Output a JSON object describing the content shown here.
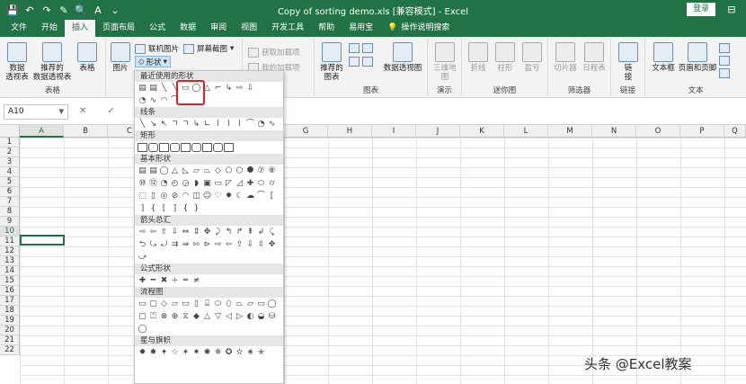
{
  "window": {
    "title": "Copy of sorting demo.xls  [兼容模式]  -  Excel",
    "login_label": "登录",
    "qat_icons": [
      "save-icon",
      "undo-icon",
      "redo-icon",
      "format-painter-icon",
      "print-preview-icon",
      "font-color-icon",
      "customize-qat-icon"
    ]
  },
  "tabs": [
    "文件",
    "开始",
    "插入",
    "页面布局",
    "公式",
    "数据",
    "审阅",
    "视图",
    "开发工具",
    "帮助",
    "易用宝"
  ],
  "active_tab": "插入",
  "tell_me": "操作说明搜索",
  "ribbon": {
    "groups": {
      "tables": {
        "label": "表格",
        "pivot": "数据\n透视表",
        "recommended_pivot": "推荐的\n数据透视表",
        "table": "表格"
      },
      "illustrations": {
        "picture": "图片",
        "online_picture": "联机图片",
        "shapes": "形状",
        "screenshot": "屏幕截图"
      },
      "addins": {
        "get_addins": "获取加载项",
        "my_addins": "我的加载项"
      },
      "charts": {
        "label": "图表",
        "recommended_charts": "推荐的\n图表",
        "pivot_chart": "数据透视图"
      },
      "tours": {
        "label": "演示",
        "map3d": "三维地\n图"
      },
      "sparklines": {
        "label": "迷你图",
        "line": "折线",
        "column": "柱形",
        "winloss": "盈亏"
      },
      "filters": {
        "label": "筛选器",
        "slicer": "切片器",
        "timeline": "日程表"
      },
      "links": {
        "label": "链接",
        "link": "链\n接"
      },
      "text": {
        "label": "文本",
        "textbox": "文本框",
        "header_footer": "页眉和页脚"
      }
    }
  },
  "formula_bar": {
    "name_box": "A10",
    "buttons": "✕ ✓ fx"
  },
  "columns": [
    "A",
    "B",
    "C",
    "D",
    "E",
    "F",
    "G",
    "H",
    "I",
    "J",
    "K",
    "L",
    "M",
    "N",
    "O",
    "P",
    "Q"
  ],
  "rows": [
    "1",
    "2",
    "3",
    "4",
    "5",
    "6",
    "7",
    "8",
    "9",
    "10",
    "11",
    "12",
    "13",
    "14",
    "15",
    "16",
    "17",
    "18",
    "19",
    "20",
    "21",
    "22"
  ],
  "selected_cell": "A10",
  "shapes_menu": {
    "categories": [
      "最近使用的形状",
      "线条",
      "矩形",
      "基本形状",
      "箭头总汇",
      "公式形状",
      "流程图",
      "星与旗帜"
    ],
    "recent_glyphs": [
      "▤",
      "▤",
      "╲",
      "╲",
      "▭",
      "◯",
      "△",
      "⌐",
      "↳",
      "⇨",
      "⇩"
    ],
    "recent_glyphs_2": [
      "◔",
      "∿",
      "◠",
      "⌒"
    ],
    "line_glyphs": [
      "╲",
      "↘",
      "↖",
      "ㄱ",
      "ㄱ",
      "↳",
      "∟",
      "⌇",
      "⌇",
      "⌇",
      "⌒",
      "◔",
      "∿"
    ],
    "rect_count": 9,
    "basic_glyphs": [
      "▤",
      "▤",
      "◯",
      "△",
      "◺",
      "▱",
      "⏢",
      "◇",
      "⬠",
      "⬡",
      "⯃",
      "⑦",
      "⑧",
      "⑩",
      "⑫",
      "◔",
      "◴",
      "◶",
      "◗",
      "▣",
      "▭",
      "◸",
      "◿",
      "✚",
      "⬭",
      "⌭",
      "⬚",
      "▯",
      "◎",
      "⊘",
      "◠",
      "◫",
      "☺",
      "♡",
      "✹",
      "☾",
      "☁",
      "⌒",
      "[",
      "]",
      "{",
      "[",
      "]",
      "{",
      "}"
    ],
    "arrow_glyphs": [
      "⇨",
      "⇦",
      "⇧",
      "⇩",
      "⇔",
      "⇕",
      "✥",
      "⤸",
      "↰",
      "↱",
      "⇞",
      "↲",
      "⤹",
      "⮌",
      "⤿",
      "⤾",
      "⇉",
      "⇛",
      "⇰",
      "⊳",
      "⇨",
      "⇦",
      "⇧",
      "⇩",
      "⇳",
      "✥",
      "⤻"
    ],
    "equation_glyphs": [
      "✚",
      "━",
      "✖",
      "÷",
      "═",
      "≠"
    ],
    "flow_glyphs": [
      "▭",
      "▢",
      "◇",
      "▱",
      "▭",
      "▯",
      "⌸",
      "⬭",
      "⬯",
      "⏢",
      "⏥",
      "▭",
      "◯",
      "▢",
      "⏍",
      "⊗",
      "⊕",
      "⧖",
      "◆",
      "△",
      "▽",
      "◁",
      "▷",
      "◐",
      "◒",
      "⛁",
      "◯"
    ],
    "star_glyphs": [
      "✹",
      "✸",
      "✦",
      "☆",
      "✶",
      "✷",
      "✺",
      "✵",
      "✪",
      "✫",
      "✬",
      "✭"
    ]
  },
  "watermark": "头条 @Excel教案"
}
